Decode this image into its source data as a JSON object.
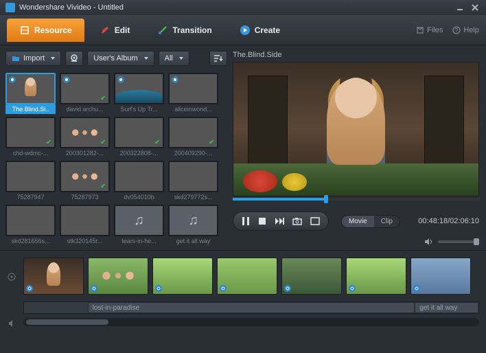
{
  "window": {
    "title": "Wondershare Vivideo - Untitled"
  },
  "tabs": {
    "resource": "Resource",
    "edit": "Edit",
    "transition": "Transition",
    "create": "Create"
  },
  "header_links": {
    "files": "Files",
    "help": "Help"
  },
  "toolbar": {
    "import": "Import",
    "album": "User's Album",
    "filter": "All"
  },
  "thumbs": [
    {
      "label": "The.Blind.Si..",
      "cls": "g-woman",
      "video": true,
      "checked": false,
      "selected": true
    },
    {
      "label": "david archu...",
      "cls": "g-band",
      "video": true,
      "checked": true
    },
    {
      "label": "Surf's Up Tr...",
      "cls": "g-wave",
      "video": true,
      "checked": true
    },
    {
      "label": "aliceinwond...",
      "cls": "g-dark",
      "video": true,
      "checked": false
    },
    {
      "label": "chd-wdmc-...",
      "cls": "g-bride",
      "video": false,
      "checked": true
    },
    {
      "label": "200301282-...",
      "cls": "g-kids",
      "video": false,
      "checked": true
    },
    {
      "label": "200322808-...",
      "cls": "g-field",
      "video": false,
      "checked": true
    },
    {
      "label": "200409290-...",
      "cls": "g-cloud",
      "video": false,
      "checked": true
    },
    {
      "label": "75287947",
      "cls": "g-family",
      "video": false,
      "checked": false
    },
    {
      "label": "75287973",
      "cls": "g-kids",
      "video": false,
      "checked": true
    },
    {
      "label": "dv054010b",
      "cls": "g-field",
      "video": false,
      "checked": false
    },
    {
      "label": "skd279772s...",
      "cls": "g-field",
      "video": false,
      "checked": false
    },
    {
      "label": "skd281656s...",
      "cls": "g-horse",
      "video": false,
      "checked": false
    },
    {
      "label": "stk320145r...",
      "cls": "g-strip",
      "video": false,
      "checked": false
    },
    {
      "label": "tears-in-he...",
      "cls": "g-a",
      "video": false,
      "checked": false,
      "audio": true
    },
    {
      "label": "get it all way",
      "cls": "g-a",
      "video": false,
      "checked": false,
      "audio": true
    }
  ],
  "preview": {
    "title": "The.Blind.Side",
    "timecode": "00:48:18/02:06:10",
    "progress_pct": 38,
    "viewmode": {
      "movie": "Movie",
      "clip": "Clip"
    }
  },
  "timeline": {
    "clips": [
      {
        "cls": "g-woman"
      },
      {
        "cls": "g-kids"
      },
      {
        "cls": "g-field"
      },
      {
        "cls": "g-family"
      },
      {
        "cls": "g-horse"
      },
      {
        "cls": "g-field"
      },
      {
        "cls": "g-cloud"
      }
    ],
    "audio": [
      {
        "label": "lost-in-paradise",
        "left_pct": 14,
        "width_pct": 72
      },
      {
        "label": "get it all way",
        "left_pct": 86,
        "width_pct": 14
      }
    ]
  }
}
